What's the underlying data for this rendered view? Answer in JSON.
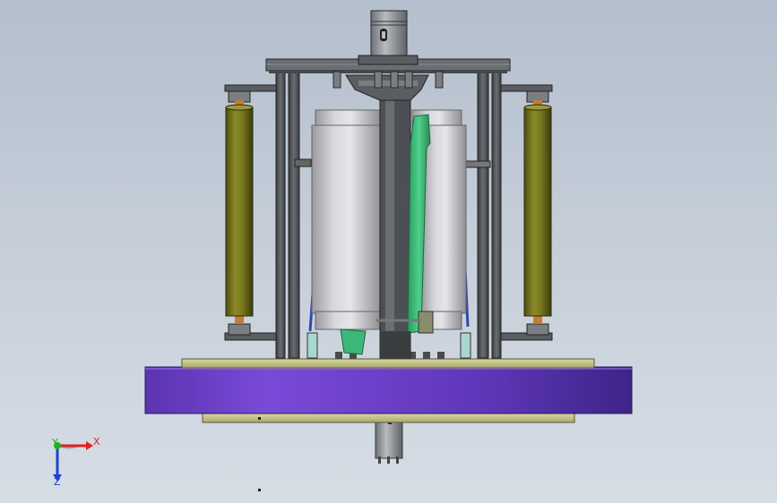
{
  "viewport": {
    "background_top": "#b4bfcd",
    "background_bottom": "#d6dde5"
  },
  "triad": {
    "x_label": "X",
    "y_label": "Y",
    "z_label": "Z",
    "x_color": "#e02020",
    "y_color": "#20b020",
    "z_color": "#2040d0"
  },
  "model": {
    "base_disc_color": "#6a3ec8",
    "plate_color": "#c8c890",
    "roller_color": "#7a7a1e",
    "drum_color": "#c8c8cc",
    "frame_color": "#55595e",
    "guide_color": "#3cb878"
  }
}
